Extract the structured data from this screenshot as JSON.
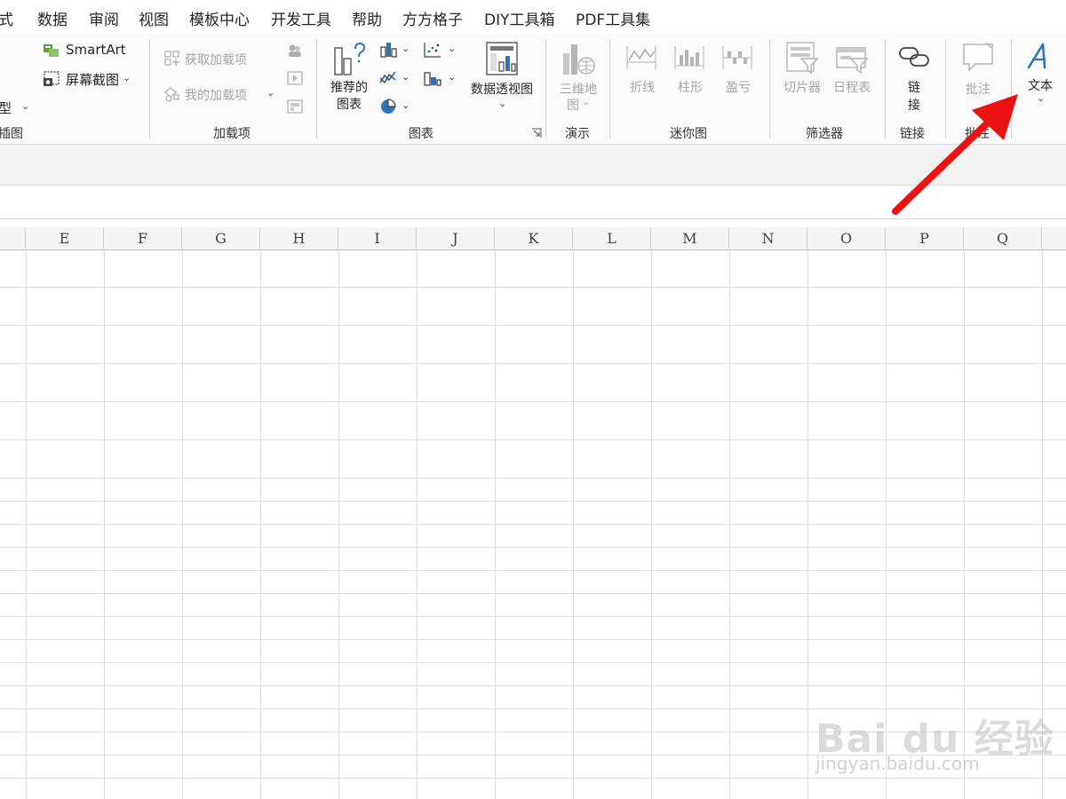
{
  "menu": [
    "式",
    "数据",
    "审阅",
    "视图",
    "模板中心",
    "开发工具",
    "帮助",
    "方方格子",
    "DIY工具箱",
    "PDF工具集"
  ],
  "ribbon": {
    "illustrations": {
      "smartart_label": "SmartArt",
      "screenshot_label": "屏幕截图",
      "model_label": "型",
      "group_label": "插图"
    },
    "addins": {
      "get_addins_label": "获取加载项",
      "my_addins_label": "我的加载项",
      "group_label": "加载项"
    },
    "charts": {
      "recommended_label_1": "推荐的",
      "recommended_label_2": "图表",
      "pivot_chart_label": "数据透视图",
      "group_label": "图表"
    },
    "tours": {
      "map3d_label_1": "三维地",
      "map3d_label_2": "图",
      "group_label": "演示"
    },
    "sparklines": {
      "line_label": "折线",
      "column_label": "柱形",
      "winloss_label": "盈亏",
      "group_label": "迷你图"
    },
    "filters": {
      "slicer_label": "切片器",
      "timeline_label": "日程表",
      "group_label": "筛选器"
    },
    "links": {
      "link_label_1": "链",
      "link_label_2": "接",
      "group_label": "链接"
    },
    "comments": {
      "comment_label": "批注",
      "group_label": "批注"
    },
    "text": {
      "text_label": "文本"
    }
  },
  "columns": [
    "E",
    "F",
    "G",
    "H",
    "I",
    "J",
    "K",
    "L",
    "M",
    "N",
    "O",
    "P",
    "Q"
  ],
  "watermark": {
    "logo": "Bai du 经验",
    "url": "jingyan.baidu.com"
  },
  "colors": {
    "accent_blue": "#2e75b6",
    "arrow_red": "#ee1111",
    "disabled_gray": "#a6a6a6"
  }
}
